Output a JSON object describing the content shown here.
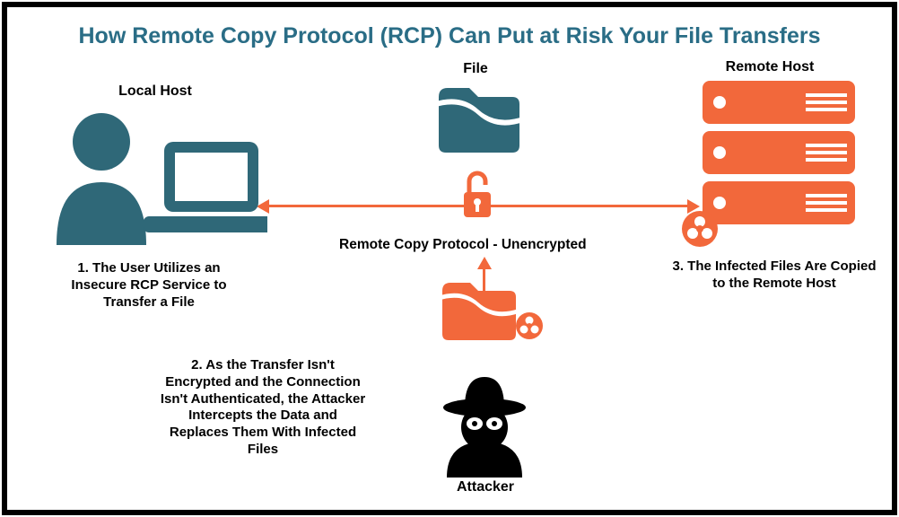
{
  "title": "How Remote Copy Protocol (RCP) Can Put at Risk Your File Transfers",
  "labels": {
    "local_host": "Local Host",
    "file": "File",
    "remote_host": "Remote Host",
    "attacker": "Attacker",
    "rcp": "Remote Copy Protocol - Unencrypted"
  },
  "captions": {
    "step1": "1. The User Utilizes an Insecure RCP Service to Transfer a File",
    "step2": "2. As the Transfer Isn't Encrypted and the Connection Isn't Authenticated, the Attacker Intercepts the Data and Replaces Them With Infected Files",
    "step3": "3. The Infected Files Are Copied to the Remote Host"
  },
  "icons": {
    "user": "user-laptop-icon",
    "file_teal": "folder-icon",
    "padlock": "open-padlock-icon",
    "servers": "server-stack-icon",
    "biohazard_big": "biohazard-icon",
    "file_infected": "folder-infected-icon",
    "biohazard_small": "biohazard-icon",
    "attacker": "attacker-icon"
  },
  "colors": {
    "teal": "#2f6878",
    "orange": "#f2683b",
    "title": "#2a6d86"
  }
}
